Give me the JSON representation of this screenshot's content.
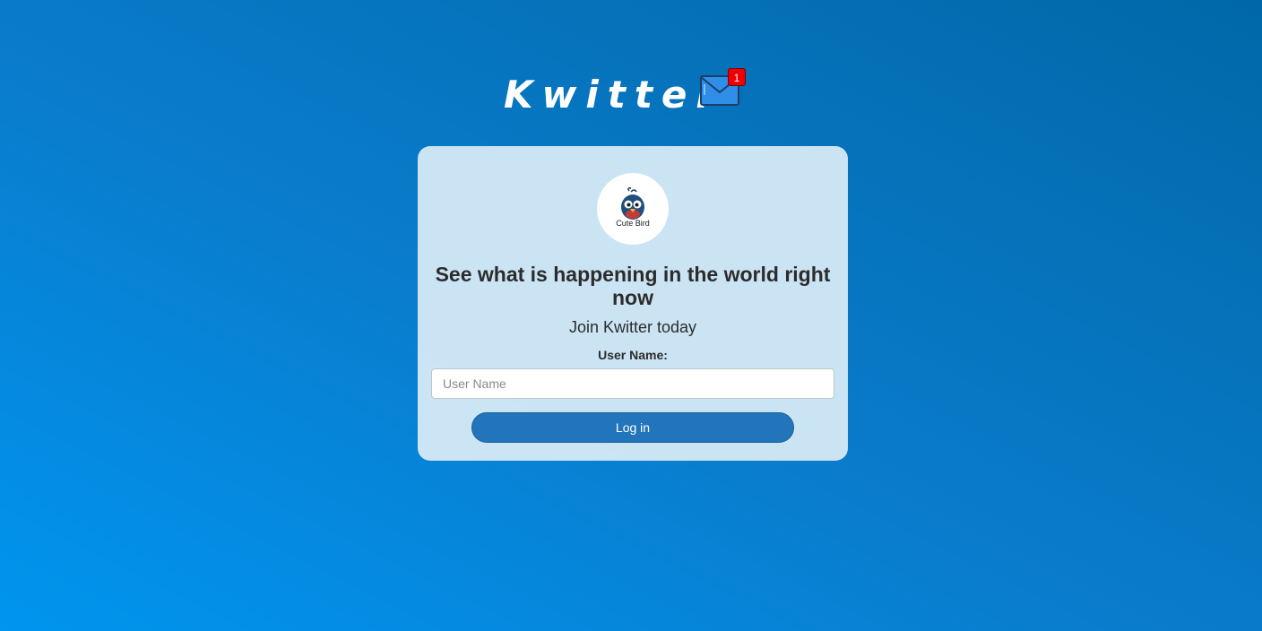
{
  "header": {
    "title": "Kwitter",
    "notification_count": "1"
  },
  "card": {
    "logo_text": "Cute Bird",
    "headline": "See what is happening in the world right now",
    "subhead": "Join Kwitter today",
    "username_label": "User Name:",
    "username_placeholder": "User Name",
    "username_value": "",
    "login_label": "Log in"
  },
  "colors": {
    "accent": "#2275ba",
    "badge": "#ee0000",
    "card_bg": "#d6eaf6"
  },
  "icons": [
    "envelope-icon",
    "cute-bird-logo"
  ]
}
